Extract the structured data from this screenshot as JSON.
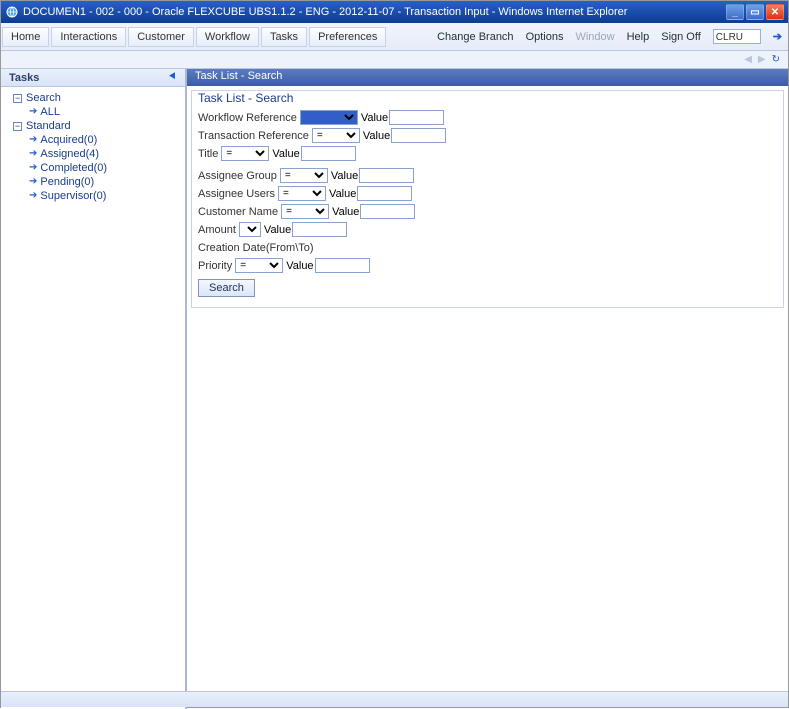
{
  "window": {
    "title": "DOCUMEN1 - 002 - 000 - Oracle FLEXCUBE UBS1.1.2 - ENG - 2012-11-07 - Transaction Input - Windows Internet Explorer"
  },
  "menu": {
    "home": "Home",
    "interactions": "Interactions",
    "customer": "Customer",
    "workflow": "Workflow",
    "tasks": "Tasks",
    "preferences": "Preferences"
  },
  "toplinks": {
    "change_branch": "Change Branch",
    "options": "Options",
    "window": "Window",
    "help": "Help",
    "signoff": "Sign Off",
    "code": "CLRU"
  },
  "sidebar": {
    "title": "Tasks",
    "search": "Search",
    "all": "ALL",
    "standard": "Standard",
    "items": [
      {
        "label": "Acquired(0)"
      },
      {
        "label": "Assigned(4)"
      },
      {
        "label": "Completed(0)"
      },
      {
        "label": "Pending(0)"
      },
      {
        "label": "Supervisor(0)"
      }
    ]
  },
  "content": {
    "header": "Task List - Search",
    "panel_title": "Task List - Search",
    "labels": {
      "workflow_ref": "Workflow Reference",
      "txn_ref": "Transaction Reference",
      "title": "Title",
      "assignee_group": "Assignee Group",
      "assignee_users": "Assignee Users",
      "customer_name": "Customer Name",
      "amount": "Amount",
      "creation_date": "Creation Date(From\\To)",
      "priority": "Priority",
      "value": "Value",
      "op_eq": "="
    },
    "search_btn": "Search"
  }
}
